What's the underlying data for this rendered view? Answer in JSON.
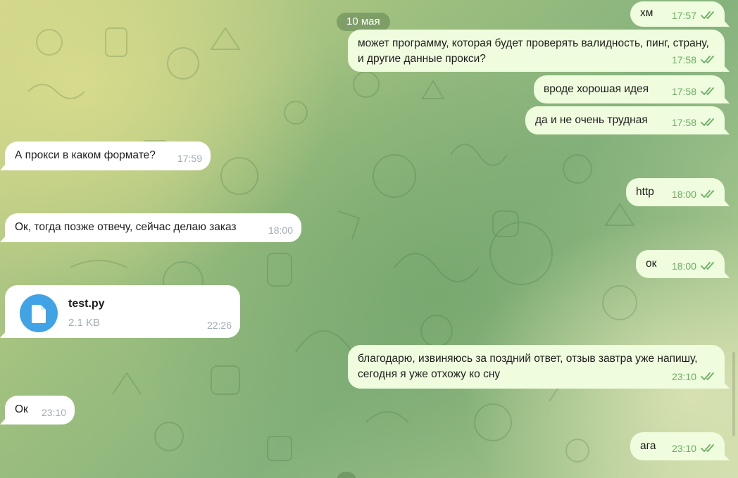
{
  "chat": {
    "date_label_top": "10 мая",
    "messages": [
      {
        "dir": "out",
        "text": "хм",
        "time": "17:57"
      },
      {
        "dir": "out",
        "text": "может программу, которая будет проверять валидность, пинг, страну, и другие данные прокси?",
        "time": "17:58"
      },
      {
        "dir": "out",
        "text": "вроде хорошая идея",
        "time": "17:58"
      },
      {
        "dir": "out",
        "text": "да и не очень трудная",
        "time": "17:58"
      },
      {
        "dir": "in",
        "text": "А прокси в каком формате?",
        "time": "17:59"
      },
      {
        "dir": "out",
        "text": "http",
        "time": "18:00"
      },
      {
        "dir": "in",
        "text": "Ок, тогда позже отвечу, сейчас делаю заказ",
        "time": "18:00"
      },
      {
        "dir": "out",
        "text": "ок",
        "time": "18:00"
      },
      {
        "dir": "in",
        "type": "file",
        "file_name": "test.py",
        "file_size": "2.1 KB",
        "file_icon": "file-icon",
        "time": "22:26"
      },
      {
        "dir": "out",
        "text": "благодарю, извиняюсь за поздний ответ, отзыв завтра уже напишу, сегодня я уже отхожу ко сну",
        "time": "23:10"
      },
      {
        "dir": "in",
        "text": "Ок",
        "time": "23:10"
      },
      {
        "dir": "out",
        "text": "ага",
        "time": "23:10"
      }
    ]
  },
  "colors": {
    "outgoing_bubble": "#effdde",
    "incoming_bubble": "#ffffff",
    "read_check": "#6aae62",
    "file_accent": "#40a3e5",
    "date_pill": "#6a9a5a"
  }
}
